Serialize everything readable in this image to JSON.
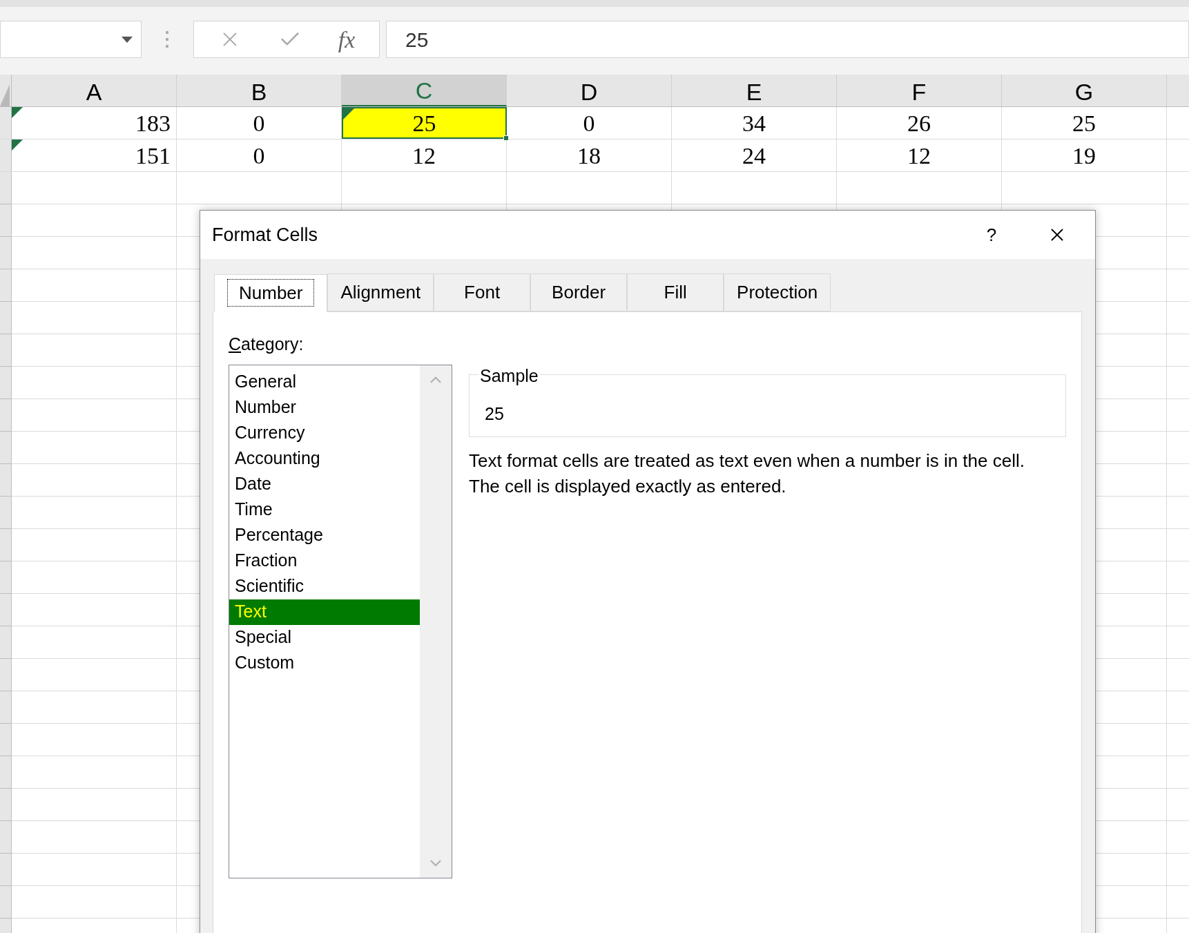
{
  "formula_bar": {
    "function_label": "fx",
    "value": "25"
  },
  "sheet": {
    "columns": [
      {
        "label": "A",
        "selected": false,
        "right_aligned": true
      },
      {
        "label": "B",
        "selected": false,
        "right_aligned": false
      },
      {
        "label": "C",
        "selected": true,
        "right_aligned": false
      },
      {
        "label": "D",
        "selected": false,
        "right_aligned": false
      },
      {
        "label": "E",
        "selected": false,
        "right_aligned": false
      },
      {
        "label": "F",
        "selected": false,
        "right_aligned": false
      },
      {
        "label": "G",
        "selected": false,
        "right_aligned": false
      }
    ],
    "rows": [
      {
        "cells": [
          {
            "value": "183",
            "flagged": true,
            "selected": false,
            "highlighted": false
          },
          {
            "value": "0",
            "flagged": false,
            "selected": false,
            "highlighted": false
          },
          {
            "value": "25",
            "flagged": true,
            "selected": true,
            "highlighted": true
          },
          {
            "value": "0",
            "flagged": false,
            "selected": false,
            "highlighted": false
          },
          {
            "value": "34",
            "flagged": false,
            "selected": false,
            "highlighted": false
          },
          {
            "value": "26",
            "flagged": false,
            "selected": false,
            "highlighted": false
          },
          {
            "value": "25",
            "flagged": false,
            "selected": false,
            "highlighted": false
          }
        ]
      },
      {
        "cells": [
          {
            "value": "151",
            "flagged": true,
            "selected": false,
            "highlighted": false
          },
          {
            "value": "0",
            "flagged": false,
            "selected": false,
            "highlighted": false
          },
          {
            "value": "12",
            "flagged": false,
            "selected": false,
            "highlighted": false
          },
          {
            "value": "18",
            "flagged": false,
            "selected": false,
            "highlighted": false
          },
          {
            "value": "24",
            "flagged": false,
            "selected": false,
            "highlighted": false
          },
          {
            "value": "12",
            "flagged": false,
            "selected": false,
            "highlighted": false
          },
          {
            "value": "19",
            "flagged": false,
            "selected": false,
            "highlighted": false
          }
        ]
      }
    ]
  },
  "dialog": {
    "title": "Format Cells",
    "help": "?",
    "tabs": [
      {
        "label": "Number",
        "selected": true
      },
      {
        "label": "Alignment",
        "selected": false
      },
      {
        "label": "Font",
        "selected": false
      },
      {
        "label": "Border",
        "selected": false
      },
      {
        "label": "Fill",
        "selected": false
      },
      {
        "label": "Protection",
        "selected": false
      }
    ],
    "category_label": "**C**ategory:",
    "categories": [
      {
        "label": "General",
        "selected": false,
        "highlighted": false
      },
      {
        "label": "Number",
        "selected": false,
        "highlighted": false
      },
      {
        "label": "Currency",
        "selected": false,
        "highlighted": false
      },
      {
        "label": "Accounting",
        "selected": false,
        "highlighted": false
      },
      {
        "label": "Date",
        "selected": false,
        "highlighted": false
      },
      {
        "label": "Time",
        "selected": false,
        "highlighted": false
      },
      {
        "label": "Percentage",
        "selected": false,
        "highlighted": false
      },
      {
        "label": "Fraction",
        "selected": false,
        "highlighted": false
      },
      {
        "label": "Scientific",
        "selected": false,
        "highlighted": false
      },
      {
        "label": "Text",
        "selected": true,
        "highlighted": true
      },
      {
        "label": "Special",
        "selected": false,
        "highlighted": false
      },
      {
        "label": "Custom",
        "selected": false,
        "highlighted": false
      }
    ],
    "sample": {
      "legend": "Sample",
      "value": "25"
    },
    "description": [
      "Text format cells are treated as text even when a number is in the cell.",
      "The cell is displayed exactly as entered."
    ]
  }
}
